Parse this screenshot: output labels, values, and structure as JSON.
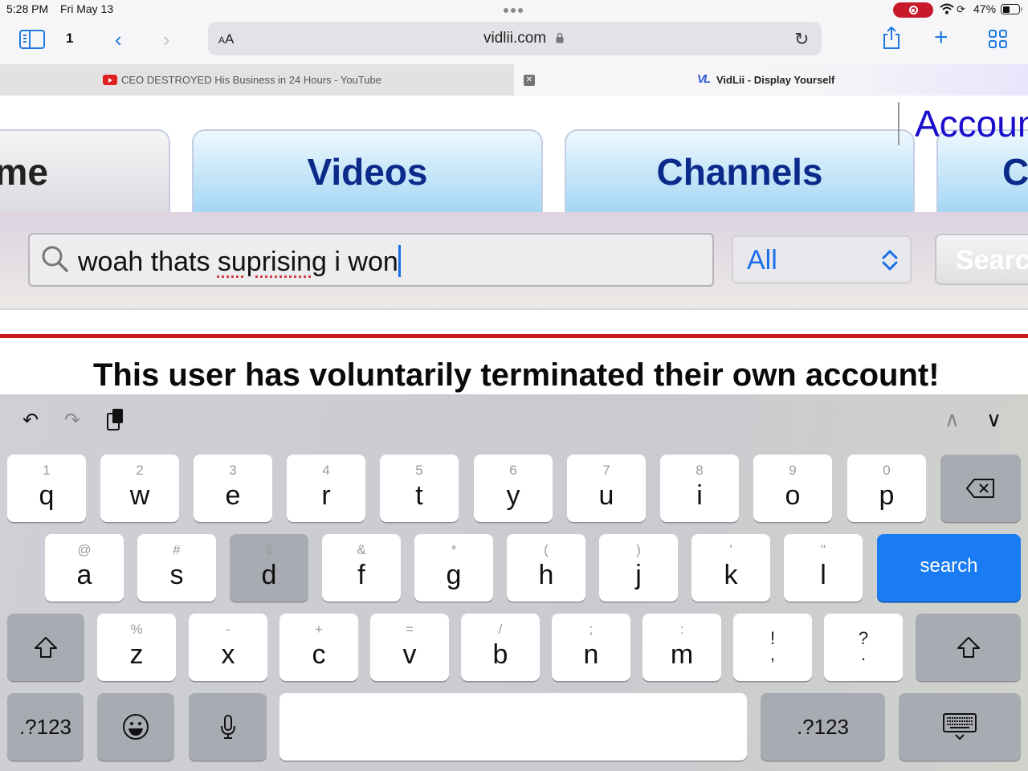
{
  "status_bar": {
    "time": "5:28 PM",
    "date": "Fri May 13",
    "battery_percent": "47%",
    "battery_level": 0.47,
    "recording_color": "#c8192a"
  },
  "toolbar": {
    "tab_count": "1",
    "text_size_label_small": "A",
    "text_size_label_large": "A",
    "url": "vidlii.com",
    "accent_color": "#1f7ae0"
  },
  "tabs": [
    {
      "title": "CEO DESTROYED His Business in 24 Hours - YouTube",
      "active": false,
      "favicon": "youtube-icon"
    },
    {
      "title": "VidLii - Display Yourself",
      "active": true,
      "favicon": "vidlii-icon",
      "favicon_text": "VL"
    }
  ],
  "page": {
    "nav_tabs": [
      {
        "label": "me",
        "full_label": "Home"
      },
      {
        "label": "Videos"
      },
      {
        "label": "Channels"
      },
      {
        "label": "C"
      }
    ],
    "account_link": "Account",
    "search": {
      "value_parts": [
        "woah thats ",
        "suprising",
        " i won"
      ],
      "misspelled_word": "suprising",
      "scope_selected": "All",
      "button_label": "Search"
    },
    "message": "This user has voluntarily terminated their own account!"
  },
  "keyboard": {
    "rows": [
      [
        {
          "pri": "q",
          "sec": "1"
        },
        {
          "pri": "w",
          "sec": "2"
        },
        {
          "pri": "e",
          "sec": "3"
        },
        {
          "pri": "r",
          "sec": "4"
        },
        {
          "pri": "t",
          "sec": "5"
        },
        {
          "pri": "y",
          "sec": "6"
        },
        {
          "pri": "u",
          "sec": "7"
        },
        {
          "pri": "i",
          "sec": "8"
        },
        {
          "pri": "o",
          "sec": "9"
        },
        {
          "pri": "p",
          "sec": "0"
        }
      ],
      [
        {
          "pri": "a",
          "sec": "@"
        },
        {
          "pri": "s",
          "sec": "#"
        },
        {
          "pri": "d",
          "sec": "$",
          "pressed": true
        },
        {
          "pri": "f",
          "sec": "&"
        },
        {
          "pri": "g",
          "sec": "*"
        },
        {
          "pri": "h",
          "sec": "("
        },
        {
          "pri": "j",
          "sec": ")"
        },
        {
          "pri": "k",
          "sec": "'"
        },
        {
          "pri": "l",
          "sec": "\""
        }
      ],
      [
        {
          "pri": "z",
          "sec": "%"
        },
        {
          "pri": "x",
          "sec": "-"
        },
        {
          "pri": "c",
          "sec": "+"
        },
        {
          "pri": "v",
          "sec": "="
        },
        {
          "pri": "b",
          "sec": "/"
        },
        {
          "pri": "n",
          "sec": ";"
        },
        {
          "pri": "m",
          "sec": ":"
        },
        {
          "pri": ",",
          "sec": "!",
          "punct": true
        },
        {
          "pri": ".",
          "sec": "?",
          "punct": true
        }
      ]
    ],
    "search_key_label": "search",
    "numbers_key_label": ".?123",
    "search_key_color": "#1a7cf5"
  }
}
